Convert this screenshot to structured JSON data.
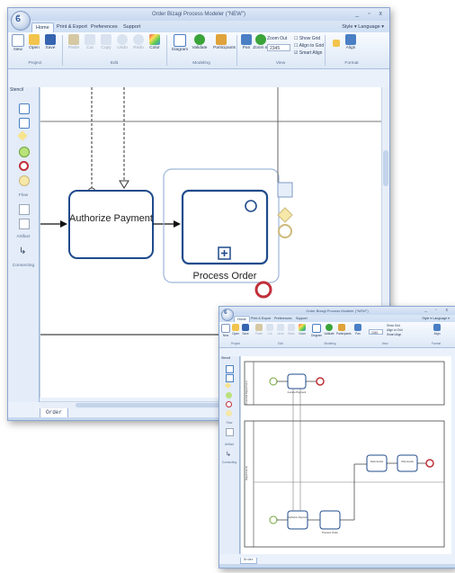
{
  "main_window": {
    "title": "Order Bizagi Process Modeler (\"NEW\")",
    "tabs": [
      "Home",
      "Print & Export",
      "Preferences",
      "Support"
    ],
    "right_menu": "Style ▾  Language ▾",
    "ribbon_buttons": {
      "new": "New",
      "open": "Open",
      "save": "Save",
      "paste": "Paste",
      "cut": "Cut",
      "copy": "Copy",
      "undo": "Undo",
      "redo": "Redo",
      "color": "Color",
      "diagram": "Diagram",
      "validate": "Validate",
      "participants": "Participants",
      "pan": "Pan",
      "zoom_in": "Zoom In",
      "zoom_out": "Zoom Out",
      "zoom_value": "2345",
      "show_grid": "Show Grid",
      "align_to_grid": "Align to Grid",
      "smart_align": "Smart Align",
      "align": "Align"
    },
    "ribbon_groups": [
      "Project",
      "Edit",
      "Modeling",
      "View",
      "Format"
    ],
    "palette": {
      "header": "Stencil",
      "flow": "Flow",
      "artifact": "Artifact",
      "connecting": "Connecting"
    },
    "canvas": {
      "task_authorize": "Authorize Payment",
      "subprocess_label": "Process Order"
    },
    "doc_tab": "Order"
  },
  "small_window": {
    "title": "Order Bizagi Process Modeler (\"NEW\")",
    "tabs": [
      "Home",
      "Print & Export",
      "Preferences",
      "Support"
    ],
    "right_menu": "Style ▾  Language ▾",
    "lanes": [
      "Financial Department",
      "Departments",
      "Production",
      "Sales"
    ],
    "tasks": {
      "authorize": "Authorize Payment",
      "process_order": "Process Order",
      "pack_goods": "Pack Goods",
      "ship_goods": "Ship Goods",
      "invoice": "Invoice Payment"
    },
    "doc_tab": "Order",
    "zoom_label": "100%"
  },
  "colors": {
    "accent": "#2a5599",
    "task_border": "#1f4b8c",
    "gateway": "#e8d35c",
    "start_event": "#9fd05a",
    "end_event": "#c0303a",
    "intermediate": "#cdb97a"
  }
}
